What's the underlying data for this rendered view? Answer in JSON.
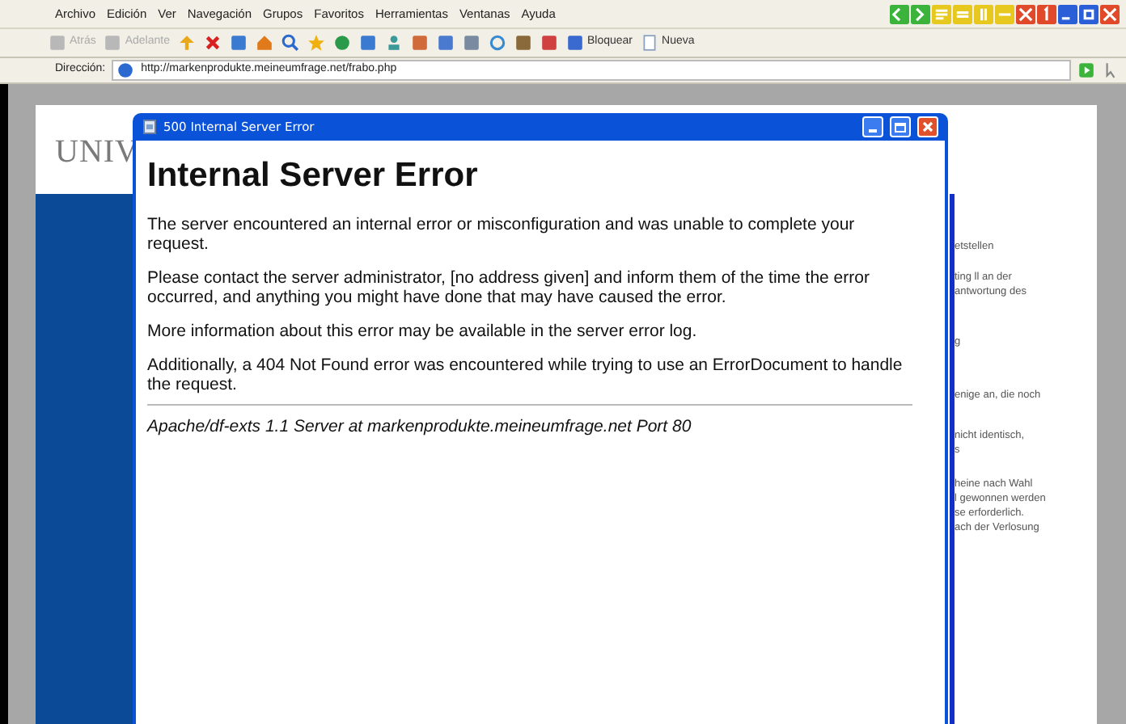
{
  "menu": [
    "Archivo",
    "Edición",
    "Ver",
    "Navegación",
    "Grupos",
    "Favoritos",
    "Herramientas",
    "Ventanas",
    "Ayuda"
  ],
  "toolbar": {
    "back": "Atrás",
    "forward": "Adelante",
    "block": "Bloquear",
    "new": "Nueva"
  },
  "address": {
    "label": "Dirección:",
    "url": "http://markenprodukte.meineumfrage.net/frabo.php"
  },
  "background_page": {
    "logo": "UNIV",
    "fragments": [
      {
        "text": "etstellen"
      },
      {
        "text": "ting ll an der\nantwortung des"
      },
      {
        "text": "g"
      },
      {
        "text": "enige an, die noch"
      },
      {
        "text": "nicht identisch,\ns"
      },
      {
        "text": "heine nach Wahl\nl gewonnen werden\nse erforderlich.\nach der Verlosung"
      }
    ]
  },
  "popup": {
    "title": "500 Internal Server Error",
    "heading": "Internal Server Error",
    "paragraphs": [
      "The server encountered an internal error or misconfiguration and was unable to complete your request.",
      "Please contact the server administrator, [no address given] and inform them of the time the error occurred, and anything you might have done that may have caused the error.",
      "More information about this error may be available in the server error log.",
      "Additionally, a 404 Not Found error was encountered while trying to use an ErrorDocument to handle the request."
    ],
    "footer": "Apache/df-exts 1.1 Server at markenprodukte.meineumfrage.net Port 80"
  }
}
